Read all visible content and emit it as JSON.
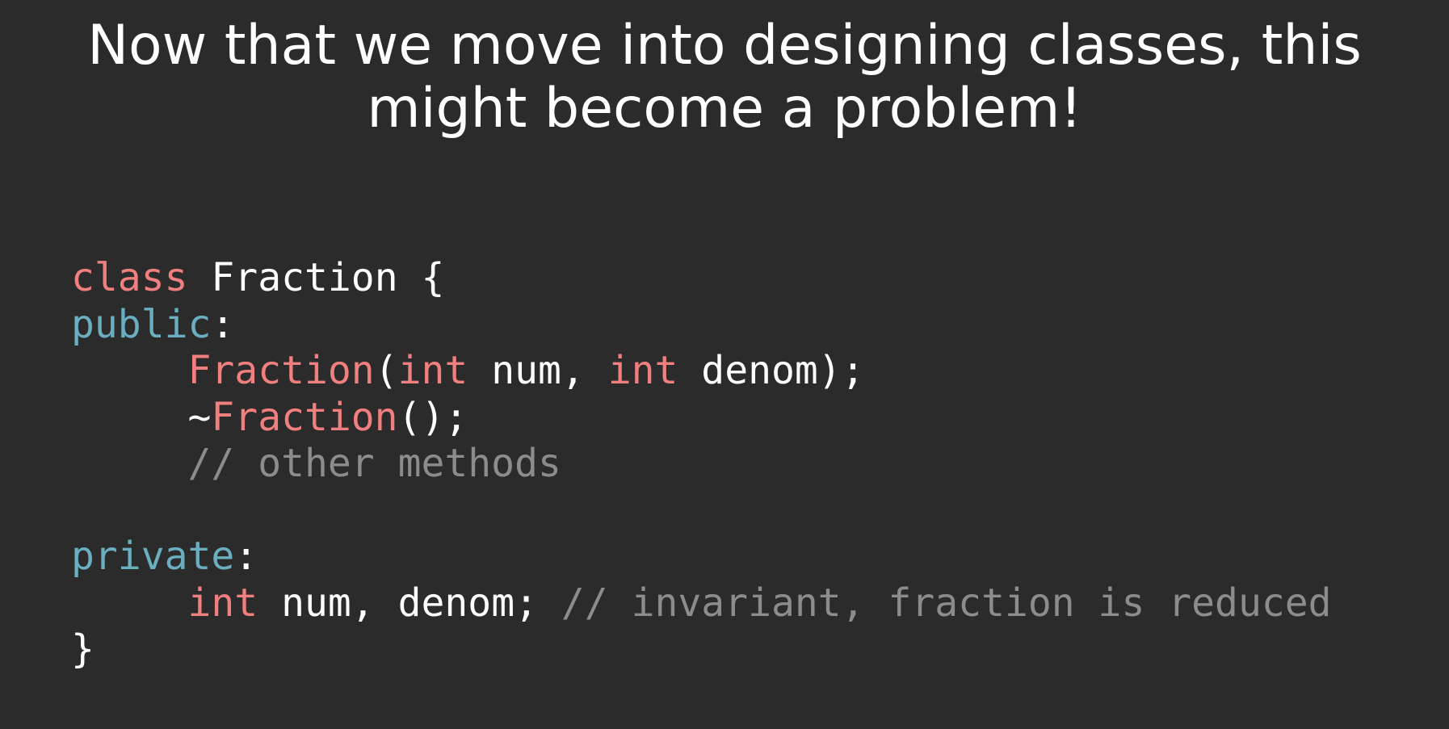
{
  "slide": {
    "title_line1": "Now that we move into designing classes, this",
    "title_line2": "might become a problem!"
  },
  "code": {
    "lines": [
      [
        {
          "t": "class",
          "c": "kw"
        },
        {
          "t": " Fraction {",
          "c": "pl"
        }
      ],
      [
        {
          "t": "public",
          "c": "acc"
        },
        {
          "t": ":",
          "c": "pl"
        }
      ],
      [
        {
          "t": "     ",
          "c": "pl"
        },
        {
          "t": "Fraction",
          "c": "kw"
        },
        {
          "t": "(",
          "c": "pl"
        },
        {
          "t": "int",
          "c": "kw"
        },
        {
          "t": " num, ",
          "c": "pl"
        },
        {
          "t": "int",
          "c": "kw"
        },
        {
          "t": " denom);",
          "c": "pl"
        }
      ],
      [
        {
          "t": "     ~",
          "c": "pl"
        },
        {
          "t": "Fraction",
          "c": "kw"
        },
        {
          "t": "();",
          "c": "pl"
        }
      ],
      [
        {
          "t": "     ",
          "c": "pl"
        },
        {
          "t": "// other methods",
          "c": "cm"
        }
      ],
      [],
      [
        {
          "t": "private",
          "c": "acc"
        },
        {
          "t": ":",
          "c": "pl"
        }
      ],
      [
        {
          "t": "     ",
          "c": "pl"
        },
        {
          "t": "int",
          "c": "kw"
        },
        {
          "t": " num, denom; ",
          "c": "pl"
        },
        {
          "t": "// invariant, fraction is reduced",
          "c": "cm"
        }
      ],
      [
        {
          "t": "}",
          "c": "pl"
        }
      ]
    ]
  },
  "colors": {
    "background": "#2b2b2b",
    "keyword": "#f07f7f",
    "access_specifier": "#6aaec0",
    "comment": "#8c8c8c",
    "text": "#ffffff"
  }
}
